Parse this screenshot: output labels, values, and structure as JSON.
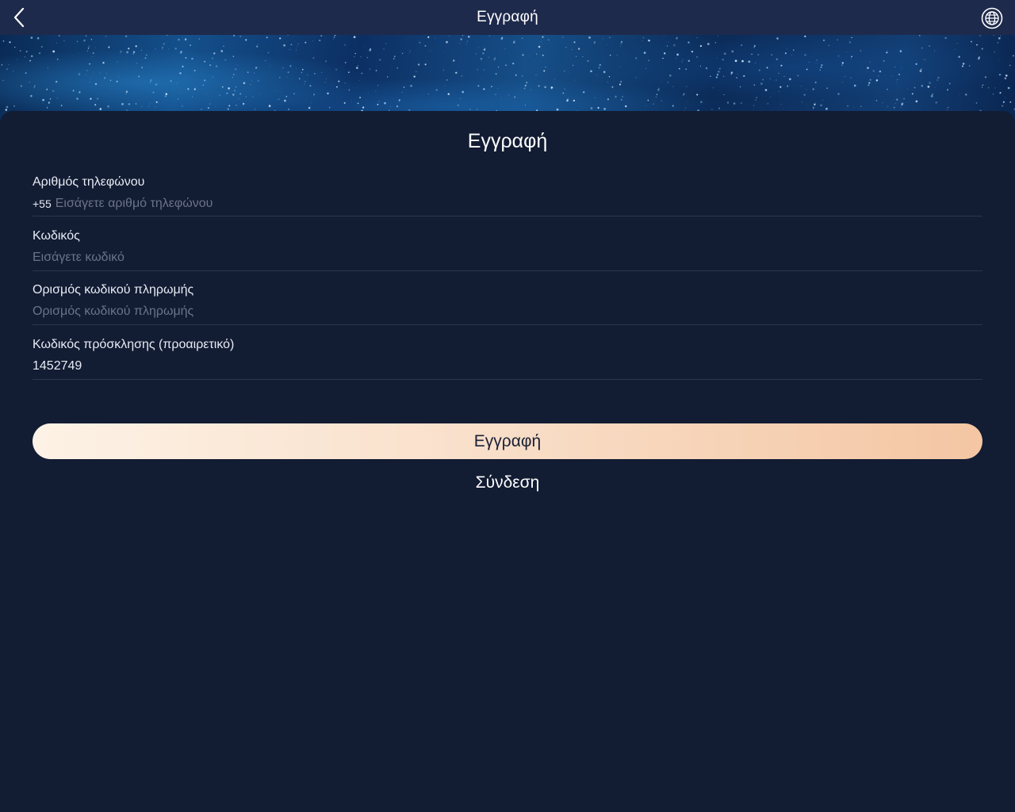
{
  "header": {
    "title": "Εγγραφή",
    "back_icon": "chevron-left-icon",
    "language_icon": "globe-icon"
  },
  "form": {
    "title": "Εγγραφή",
    "phone": {
      "label": "Αριθμός τηλεφώνου",
      "country_code": "+55",
      "placeholder": "Εισάγετε αριθμό τηλεφώνου",
      "value": ""
    },
    "password": {
      "label": "Κωδικός",
      "placeholder": "Εισάγετε κωδικό",
      "value": ""
    },
    "payment_password": {
      "label": "Ορισμός κωδικού πληρωμής",
      "placeholder": "Ορισμός κωδικού πληρωμής",
      "value": ""
    },
    "invite_code": {
      "label": "Κωδικός πρόσκλησης (προαιρετικό)",
      "placeholder": "",
      "value": "1452749"
    },
    "register_label": "Εγγραφή",
    "login_label": "Σύνδεση"
  },
  "colors": {
    "background": "#121c33",
    "navbar": "#1e2a4b",
    "button_gradient_start": "#fdf2e6",
    "button_gradient_end": "#f4c6a3",
    "placeholder": "#6b7386",
    "divider": "#2c3650"
  }
}
